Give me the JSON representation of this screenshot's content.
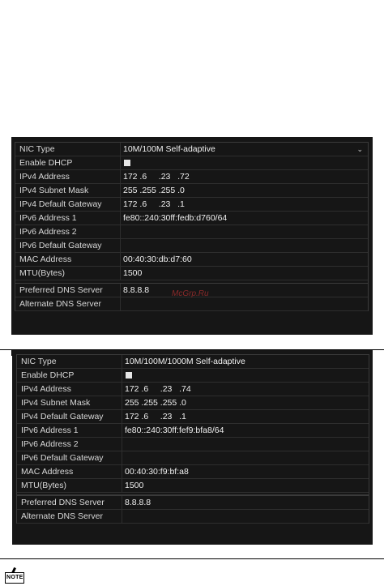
{
  "panel1": {
    "rows": [
      {
        "label": "NIC Type",
        "value": "10M/100M Self-adaptive",
        "dropdown": true
      },
      {
        "label": "Enable DHCP",
        "checkbox": true
      },
      {
        "label": "IPv4 Address",
        "value": "172 .6     .23   .72"
      },
      {
        "label": "IPv4 Subnet Mask",
        "value": "255 .255 .255 .0"
      },
      {
        "label": "IPv4 Default Gateway",
        "value": "172 .6     .23   .1"
      },
      {
        "label": "IPv6 Address 1",
        "value": "fe80::240:30ff:fedb:d760/64"
      },
      {
        "label": "IPv6 Address 2",
        "value": ""
      },
      {
        "label": "IPv6 Default Gateway",
        "value": ""
      },
      {
        "label": "MAC Address",
        "value": "00:40:30:db:d7:60"
      },
      {
        "label": "MTU(Bytes)",
        "value": "1500"
      }
    ],
    "dns_rows": [
      {
        "label": "Preferred DNS Server",
        "value": "8.8.8.8"
      },
      {
        "label": "Alternate DNS Server",
        "value": ""
      }
    ]
  },
  "panel2": {
    "rows": [
      {
        "label": "NIC Type",
        "value": "10M/100M/1000M Self-adaptive"
      },
      {
        "label": "Enable DHCP",
        "checkbox": true
      },
      {
        "label": "IPv4 Address",
        "value": "172 .6     .23   .74"
      },
      {
        "label": "IPv4 Subnet Mask",
        "value": "255 .255 .255 .0"
      },
      {
        "label": "IPv4 Default Gateway",
        "value": "172 .6     .23   .1"
      },
      {
        "label": "IPv6 Address 1",
        "value": "fe80::240:30ff:fef9:bfa8/64"
      },
      {
        "label": "IPv6 Address 2",
        "value": ""
      },
      {
        "label": "IPv6 Default Gateway",
        "value": ""
      },
      {
        "label": "MAC Address",
        "value": "00:40:30:f9:bf:a8"
      },
      {
        "label": "MTU(Bytes)",
        "value": "1500"
      }
    ],
    "dns_rows": [
      {
        "label": "Preferred DNS Server",
        "value": "8.8.8.8"
      },
      {
        "label": "Alternate DNS Server",
        "value": ""
      }
    ]
  },
  "watermark": "McGrp.Ru",
  "note_icon_label": "NOTE",
  "icons": {
    "dropdown": "chevron-down-icon",
    "checkbox": "checkbox-icon",
    "note": "note-icon"
  }
}
